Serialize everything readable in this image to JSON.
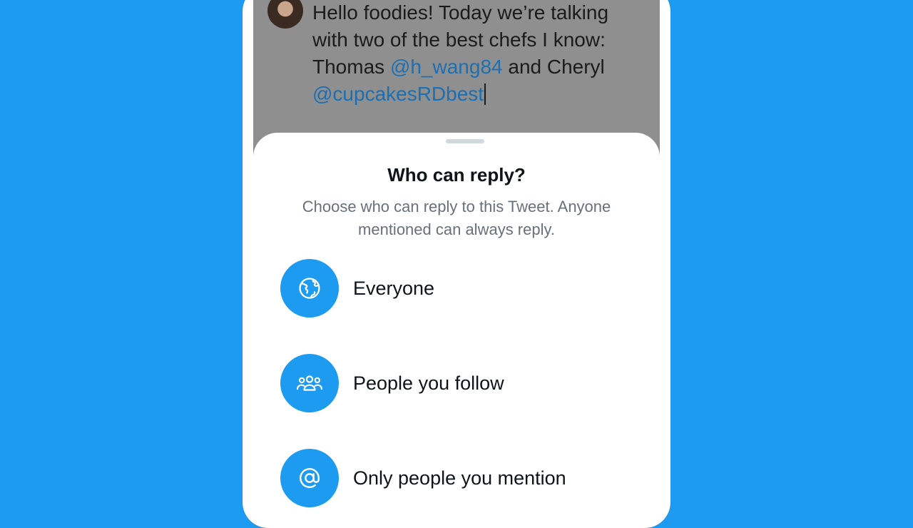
{
  "tweet": {
    "line1": "Hello foodies! Today we’re talking",
    "line2": "with two of the best chefs I know:",
    "line3_prefix": "Thomas ",
    "mention1": "@h_wang84",
    "line3_suffix": " and Cheryl",
    "mention2": "@cupcakesRDbest"
  },
  "sheet": {
    "title": "Who can reply?",
    "subtitle_line1": "Choose who can reply to this Tweet. Anyone",
    "subtitle_line2": "mentioned can always reply.",
    "options": [
      {
        "label": "Everyone",
        "icon": "globe-icon"
      },
      {
        "label": "People you follow",
        "icon": "people-icon"
      },
      {
        "label": "Only people you mention",
        "icon": "at-icon"
      }
    ]
  },
  "colors": {
    "background": "#1d9bf0",
    "accent": "#1d9bf0",
    "mention": "#1d6fb3",
    "dim_overlay": "#8f8f8f"
  }
}
